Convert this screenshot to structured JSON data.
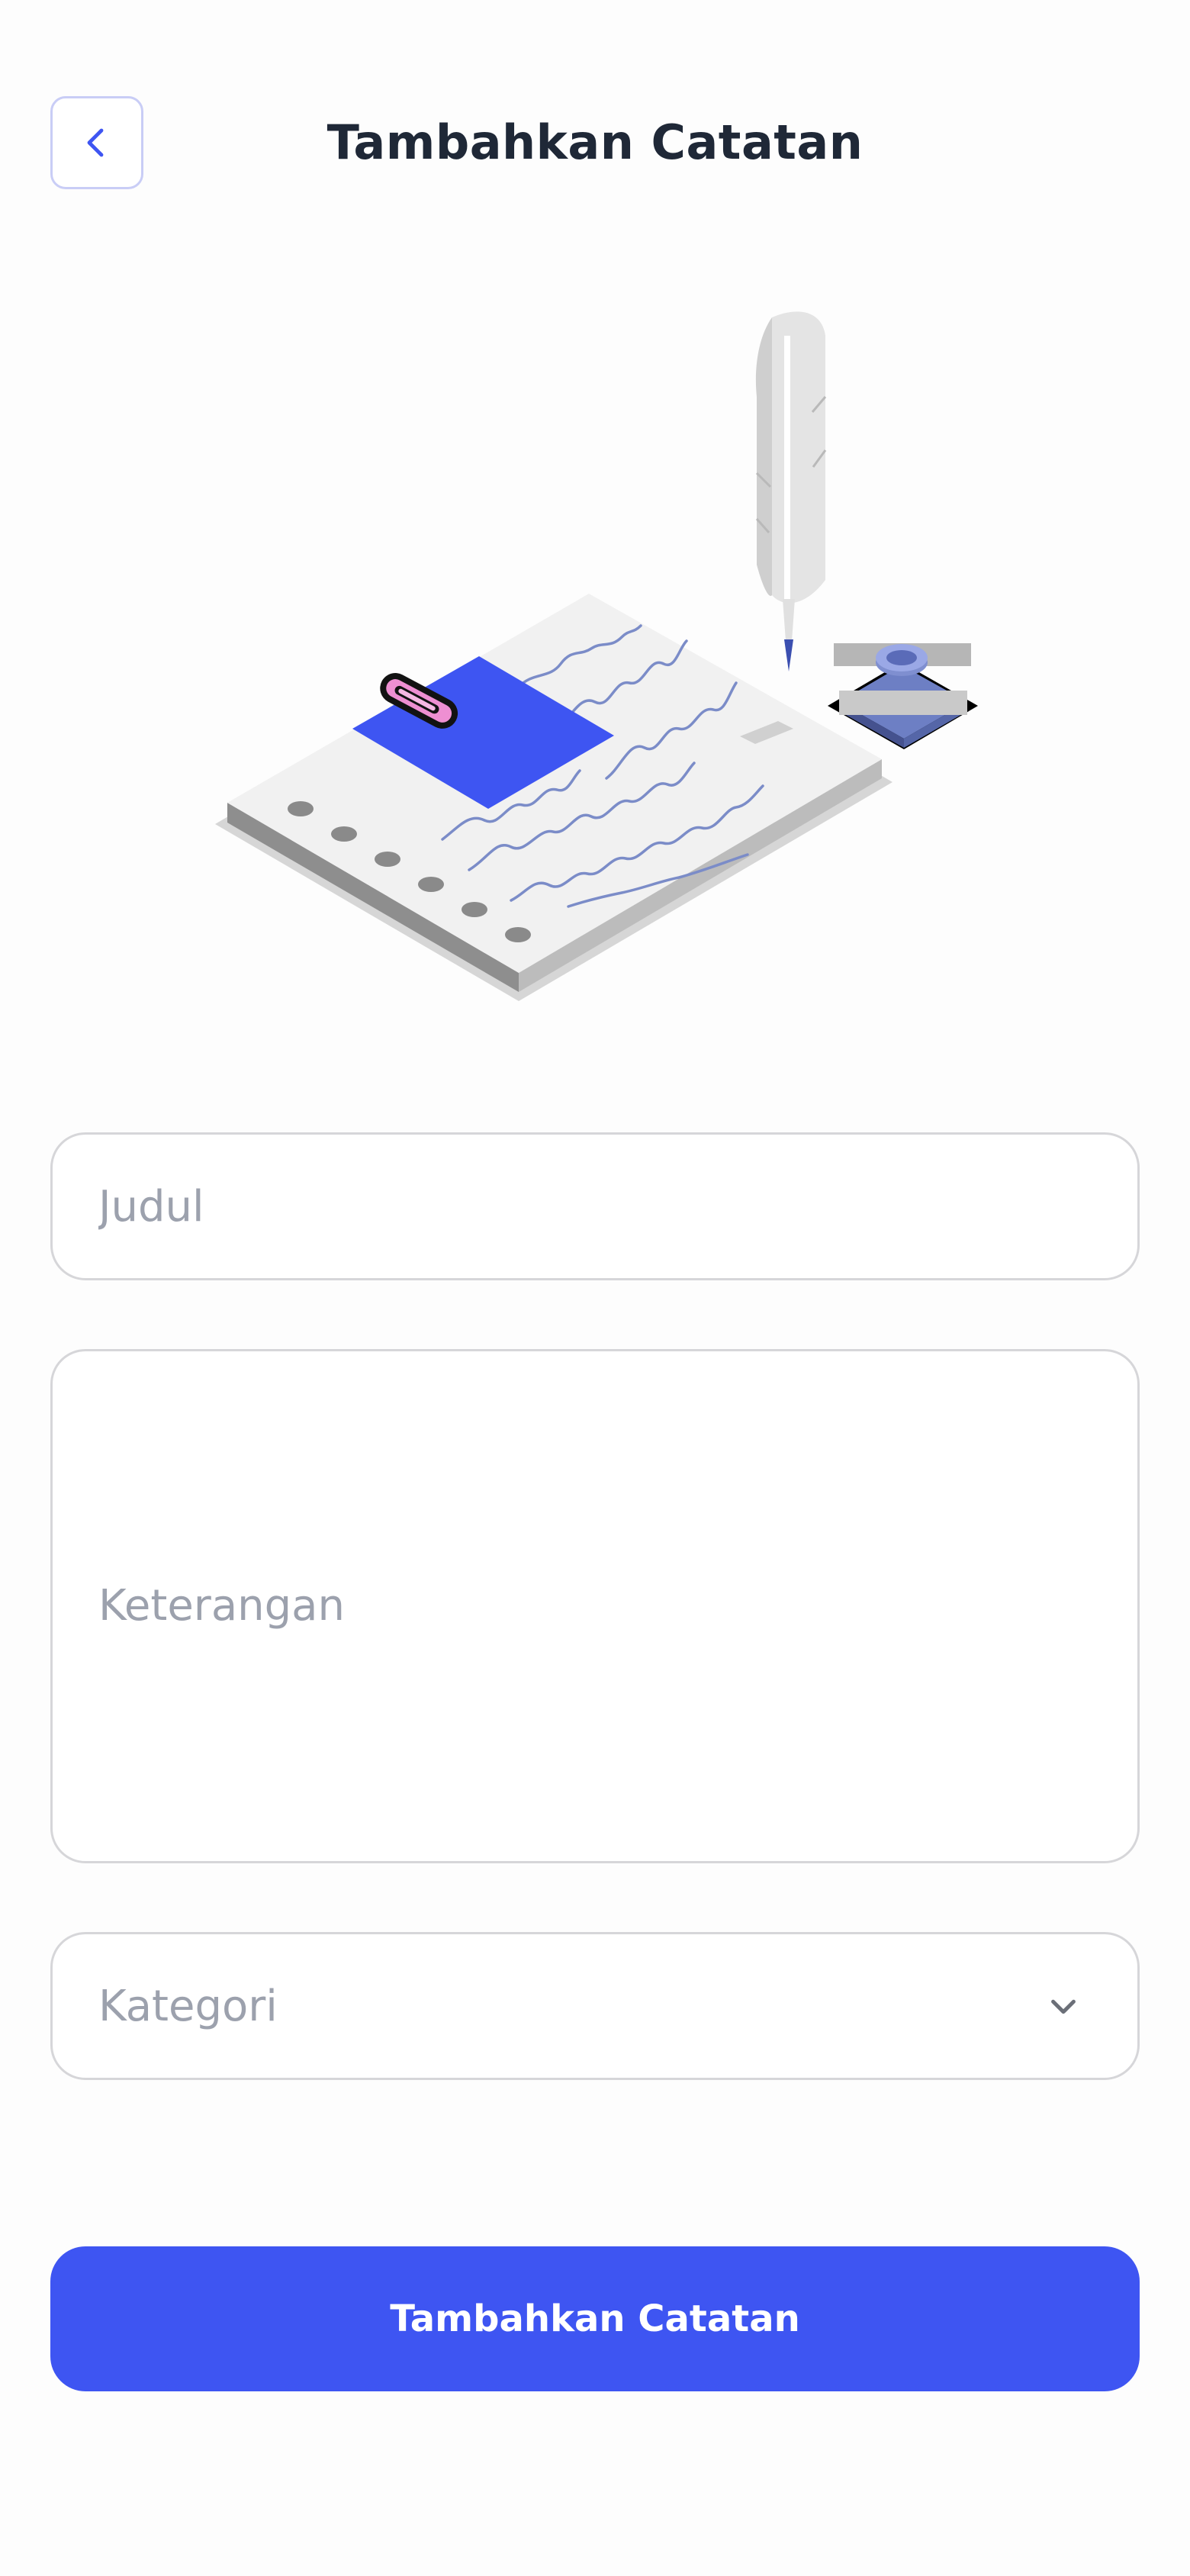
{
  "header": {
    "title": "Tambahkan Catatan",
    "back_icon": "chevron-left-icon"
  },
  "illustration": {
    "name": "notebook-quill-illustration"
  },
  "form": {
    "title_placeholder": "Judul",
    "description_placeholder": "Keterangan",
    "category_placeholder": "Kategori",
    "category_icon": "chevron-down-icon",
    "submit_label": "Tambahkan Catatan"
  },
  "colors": {
    "primary": "#3e55f2",
    "title_text": "#1f2837",
    "placeholder_text": "#9ca1ad",
    "field_border": "#d6d6d9",
    "back_border": "#c9cdf6"
  }
}
